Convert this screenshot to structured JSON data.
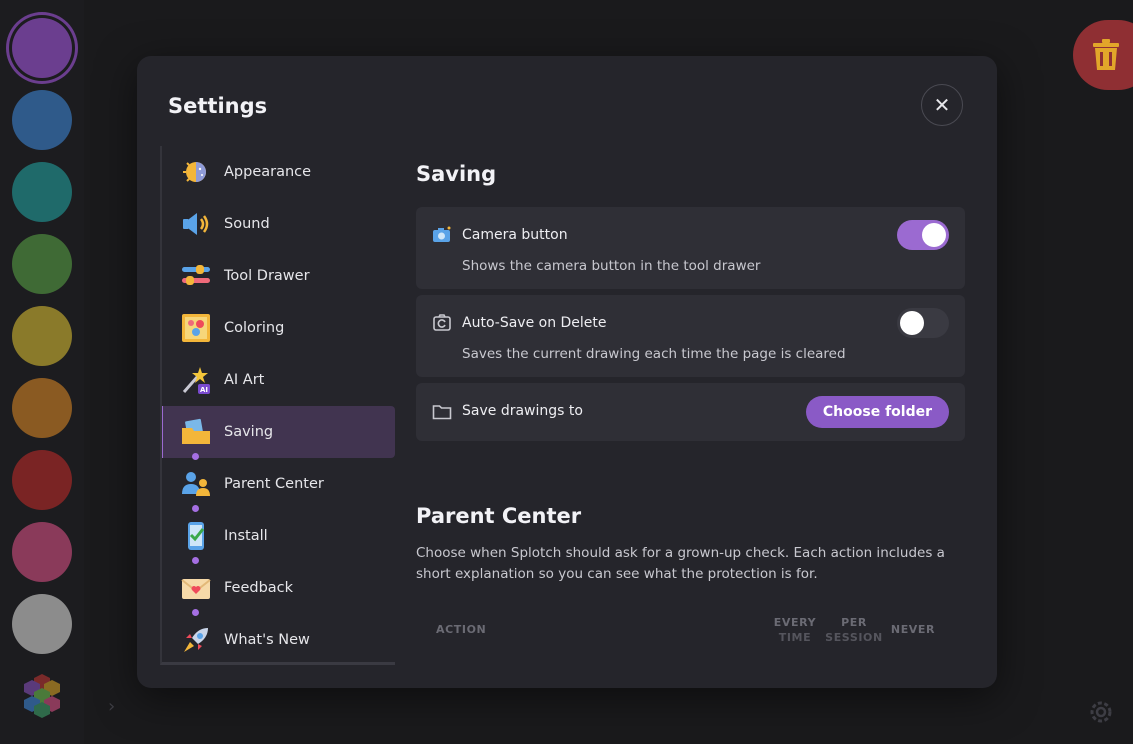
{
  "palette": {
    "swatches": [
      {
        "name": "purple",
        "color": "#6b3e8f",
        "selected": true
      },
      {
        "name": "blue",
        "color": "#2f5a8a"
      },
      {
        "name": "teal",
        "color": "#1f6a6a"
      },
      {
        "name": "green",
        "color": "#3f6a35"
      },
      {
        "name": "olive",
        "color": "#8a7a2a"
      },
      {
        "name": "orange",
        "color": "#8a5a22"
      },
      {
        "name": "red",
        "color": "#7a2424"
      },
      {
        "name": "pink",
        "color": "#8a3a5a"
      },
      {
        "name": "gray",
        "color": "#8c8c8c"
      }
    ],
    "more_icon": "color-palette-icon"
  },
  "trash_icon": "trash-icon",
  "settings_icon": "gear-icon",
  "modal": {
    "title": "Settings",
    "close_icon": "close-icon",
    "nav": [
      {
        "label": "Appearance",
        "icon": "appearance-icon",
        "active": false,
        "dot": false
      },
      {
        "label": "Sound",
        "icon": "speaker-icon",
        "active": false,
        "dot": false
      },
      {
        "label": "Tool Drawer",
        "icon": "sliders-icon",
        "active": false,
        "dot": false
      },
      {
        "label": "Coloring",
        "icon": "coloring-icon",
        "active": false,
        "dot": false
      },
      {
        "label": "AI Art",
        "icon": "magic-wand-icon",
        "active": false,
        "dot": false
      },
      {
        "label": "Saving",
        "icon": "folder-icon",
        "active": true,
        "dot": false
      },
      {
        "label": "Parent Center",
        "icon": "parents-icon",
        "active": false,
        "dot": true
      },
      {
        "label": "Install",
        "icon": "phone-check-icon",
        "active": false,
        "dot": true
      },
      {
        "label": "Feedback",
        "icon": "envelope-heart-icon",
        "active": false,
        "dot": true
      },
      {
        "label": "What's New",
        "icon": "rocket-icon",
        "active": false,
        "dot": true
      }
    ],
    "saving": {
      "title": "Saving",
      "camera": {
        "title": "Camera button",
        "desc": "Shows the camera button in the tool drawer",
        "enabled": true
      },
      "autosave": {
        "title": "Auto-Save on Delete",
        "desc": "Saves the current drawing each time the page is cleared",
        "enabled": false
      },
      "save_to": {
        "title": "Save drawings to",
        "button": "Choose folder"
      }
    },
    "parent_center": {
      "title": "Parent Center",
      "desc": "Choose when Splotch should ask for a grown-up check. Each action includes a short explanation so you can see what the protection is for.",
      "headers": {
        "action": "ACTION",
        "every_1": "EVERY",
        "every_2": "TIME",
        "per_1": "PER",
        "per_2": "SESSION",
        "never": "NEVER"
      }
    }
  },
  "colors": {
    "accent": "#9b6ad1",
    "button": "#8a5ac6",
    "trash": "#8f2f33",
    "trash_icon": "#e2a62a"
  }
}
